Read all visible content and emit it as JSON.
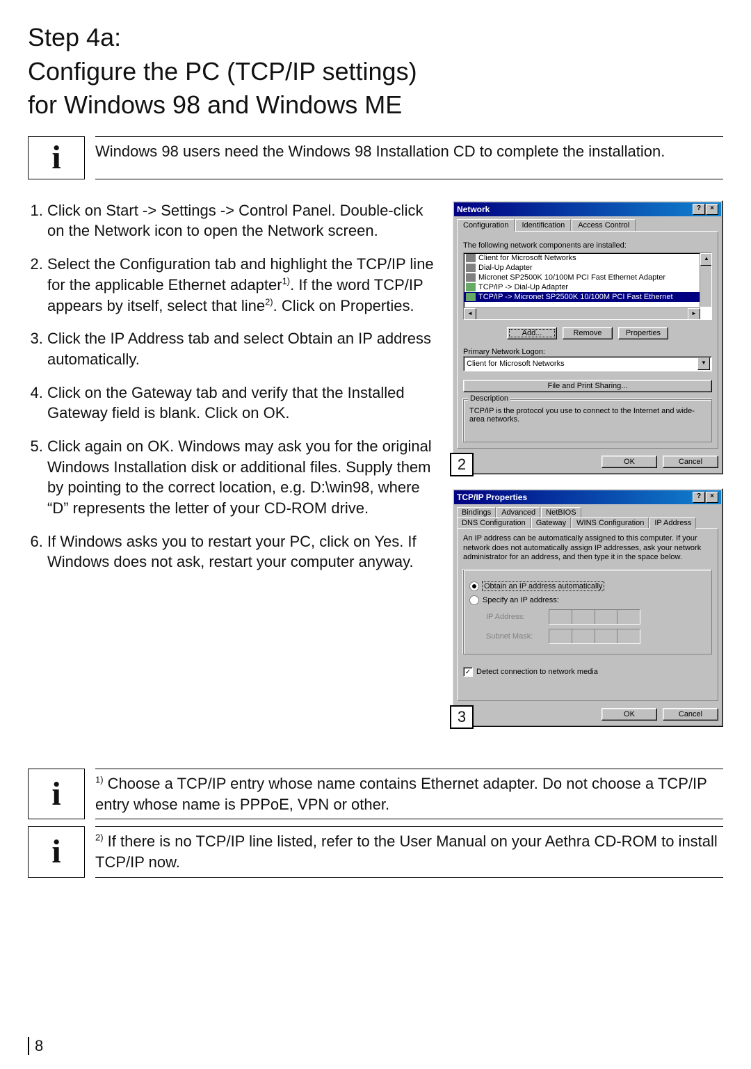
{
  "title": "Step 4a:\nConfigure the PC (TCP/IP settings)\nfor Windows 98 and Windows ME",
  "info_top": "Windows 98 users need the Windows 98 Installation CD to complete the installation.",
  "steps": {
    "s1": "Click on Start -> Settings -> Control Panel. Double-click on the Network icon to open the Network screen.",
    "s2_a": "Select the Configuration tab and highlight the TCP/IP line for the applicable Ethernet adapter",
    "s2_b": ". If the word TCP/IP appears by itself, select that line",
    "s2_c": ". Click on Properties.",
    "s3": "Click the IP Address tab and select Obtain an IP address automatically.",
    "s4": "Click on the Gateway tab and verify that the Installed Gateway field is blank. Click on OK.",
    "s5": "Click again on OK. Windows may ask you for the original Windows Installation disk or additional files. Supply them by pointing to the correct location, e.g. D:\\win98, where “D” represents the letter of your CD-ROM drive.",
    "s6": "If Windows asks you to restart your PC, click on Yes. If Windows does not ask, restart your computer anyway."
  },
  "footnote1_sup": "1)",
  "footnote1": " Choose a TCP/IP entry whose name contains Ethernet adapter. Do not choose a TCP/IP entry whose name is PPPoE, VPN or other.",
  "footnote2_sup": "2)",
  "footnote2": " If there is no TCP/IP line listed, refer to the User Manual on your Aethra CD-ROM to install TCP/IP now.",
  "marker2": "2",
  "marker3": "3",
  "page_number": "8",
  "network_dialog": {
    "title": "Network",
    "help": "?",
    "close": "×",
    "tabs": {
      "configuration": "Configuration",
      "identification": "Identification",
      "access_control": "Access Control"
    },
    "installed_label": "The following network components are installed:",
    "list": {
      "i0": "Client for Microsoft Networks",
      "i1": "Dial-Up Adapter",
      "i2": "Micronet SP2500K 10/100M PCI Fast Ethernet Adapter",
      "i3": "TCP/IP -> Dial-Up Adapter",
      "i4": "TCP/IP -> Micronet SP2500K 10/100M PCI Fast Ethernet"
    },
    "add": "Add...",
    "remove": "Remove",
    "properties": "Properties",
    "primary_logon_label": "Primary Network Logon:",
    "primary_logon_value": "Client for Microsoft Networks",
    "file_print": "File and Print Sharing...",
    "description_legend": "Description",
    "description_text": "TCP/IP is the protocol you use to connect to the Internet and wide-area networks.",
    "ok": "OK",
    "cancel": "Cancel"
  },
  "tcpip_dialog": {
    "title": "TCP/IP Properties",
    "help": "?",
    "close": "×",
    "tabs_row1": {
      "bindings": "Bindings",
      "advanced": "Advanced",
      "netbios": "NetBIOS"
    },
    "tabs_row2": {
      "dns": "DNS Configuration",
      "gateway": "Gateway",
      "wins": "WINS Configuration",
      "ip": "IP Address"
    },
    "blurb": "An IP address can be automatically assigned to this computer. If your network does not automatically assign IP addresses, ask your network administrator for an address, and then type it in the space below.",
    "radio_auto": "Obtain an IP address automatically",
    "radio_specify": "Specify an IP address:",
    "ip_label": "IP Address:",
    "mask_label": "Subnet Mask:",
    "detect": "Detect connection to network media",
    "ok": "OK",
    "cancel": "Cancel"
  }
}
